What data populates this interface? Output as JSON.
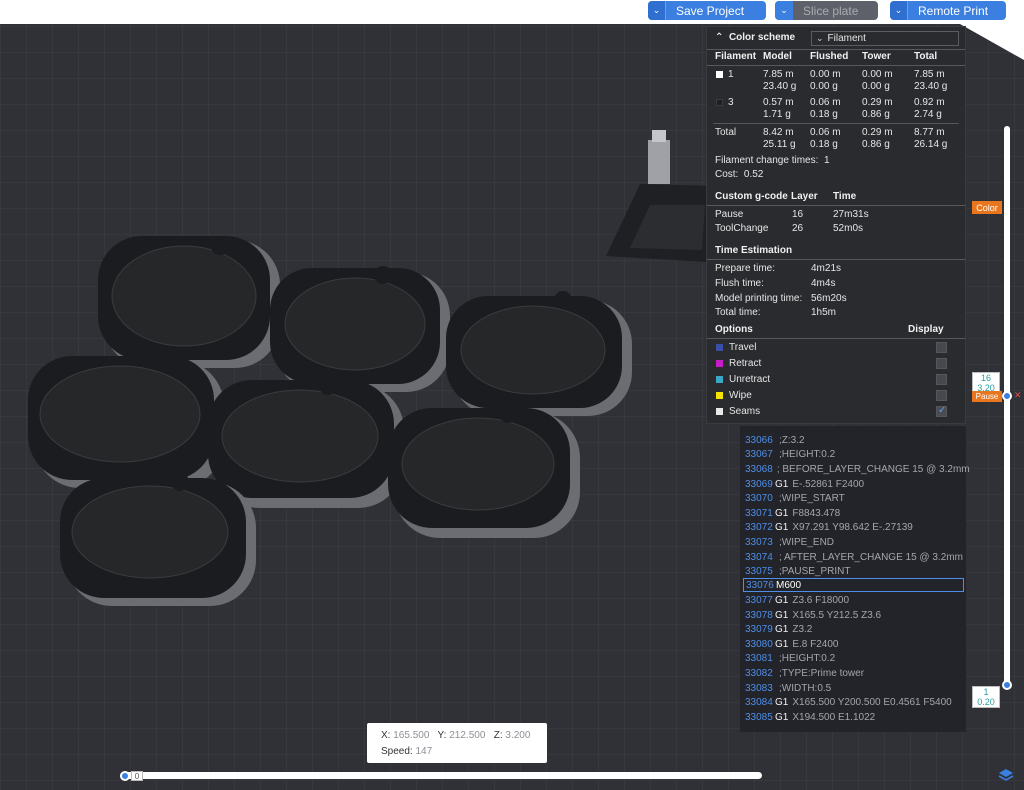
{
  "toolbar": {
    "save_project": "Save Project",
    "slice_plate": "Slice plate",
    "remote_print": "Remote Print"
  },
  "color_scheme": {
    "title": "Color scheme",
    "selected": "Filament"
  },
  "filament_table": {
    "headers": [
      "Filament",
      "Model",
      "Flushed",
      "Tower",
      "Total"
    ],
    "rows": [
      {
        "id": "1",
        "color": "#ffffff",
        "model": [
          "7.85 m",
          "23.40 g"
        ],
        "flushed": [
          "0.00 m",
          "0.00 g"
        ],
        "tower": [
          "0.00 m",
          "0.00 g"
        ],
        "total": [
          "7.85 m",
          "23.40 g"
        ]
      },
      {
        "id": "3",
        "color": "#2f3136",
        "model": [
          "0.57 m",
          "1.71 g"
        ],
        "flushed": [
          "0.06 m",
          "0.18 g"
        ],
        "tower": [
          "0.29 m",
          "0.86 g"
        ],
        "total": [
          "0.92 m",
          "2.74 g"
        ]
      }
    ],
    "total": {
      "label": "Total",
      "model": [
        "8.42 m",
        "25.11 g"
      ],
      "flushed": [
        "0.06 m",
        "0.18 g"
      ],
      "tower": [
        "0.29 m",
        "0.86 g"
      ],
      "total": [
        "8.77 m",
        "26.14 g"
      ]
    },
    "change_times_label": "Filament change times:",
    "change_times_value": "1",
    "cost_label": "Cost:",
    "cost_value": "0.52"
  },
  "custom_gcode": {
    "headers": [
      "Custom g-code",
      "Layer",
      "Time"
    ],
    "rows": [
      {
        "name": "Pause",
        "layer": "16",
        "time": "27m31s"
      },
      {
        "name": "ToolChange",
        "layer": "26",
        "time": "52m0s"
      }
    ]
  },
  "time_estimation": {
    "title": "Time Estimation",
    "rows": [
      {
        "label": "Prepare time:",
        "value": "4m21s"
      },
      {
        "label": "Flush time:",
        "value": "4m4s"
      },
      {
        "label": "Model printing time:",
        "value": "56m20s"
      },
      {
        "label": "Total time:",
        "value": "1h5m"
      }
    ]
  },
  "options": {
    "title": "Options",
    "display_header": "Display",
    "items": [
      {
        "label": "Travel",
        "color": "#3b4fa8",
        "checked": false
      },
      {
        "label": "Retract",
        "color": "#c51ec9",
        "checked": false
      },
      {
        "label": "Unretract",
        "color": "#3aa7c9",
        "checked": false
      },
      {
        "label": "Wipe",
        "color": "#f2e400",
        "checked": false
      },
      {
        "label": "Seams",
        "color": "#e8e8e8",
        "checked": true
      }
    ]
  },
  "gcode_lines": [
    {
      "num": "33066",
      "op": "",
      "text": ";Z:3.2"
    },
    {
      "num": "33067",
      "op": "",
      "text": ";HEIGHT:0.2"
    },
    {
      "num": "33068",
      "op": "",
      "text": "; BEFORE_LAYER_CHANGE 15 @ 3.2mm"
    },
    {
      "num": "33069",
      "op": "G1",
      "text": "E-.52861 F2400"
    },
    {
      "num": "33070",
      "op": "",
      "text": ";WIPE_START"
    },
    {
      "num": "33071",
      "op": "G1",
      "text": "F8843.478"
    },
    {
      "num": "33072",
      "op": "G1",
      "text": "X97.291 Y98.642 E-.27139"
    },
    {
      "num": "33073",
      "op": "",
      "text": ";WIPE_END"
    },
    {
      "num": "33074",
      "op": "",
      "text": "; AFTER_LAYER_CHANGE 15 @ 3.2mm"
    },
    {
      "num": "33075",
      "op": "",
      "text": ";PAUSE_PRINT"
    },
    {
      "num": "33076",
      "op": "M600",
      "text": ""
    },
    {
      "num": "33077",
      "op": "G1",
      "text": "Z3.6 F18000"
    },
    {
      "num": "33078",
      "op": "G1",
      "text": "X165.5 Y212.5 Z3.6"
    },
    {
      "num": "33079",
      "op": "G1",
      "text": "Z3.2"
    },
    {
      "num": "33080",
      "op": "G1",
      "text": "E.8 F2400"
    },
    {
      "num": "33081",
      "op": "",
      "text": ";HEIGHT:0.2"
    },
    {
      "num": "33082",
      "op": "",
      "text": ";TYPE:Prime tower"
    },
    {
      "num": "33083",
      "op": "",
      "text": ";WIDTH:0.5"
    },
    {
      "num": "33084",
      "op": "G1",
      "text": "X165.500 Y200.500 E0.4561 F5400"
    },
    {
      "num": "33085",
      "op": "G1",
      "text": "X194.500 E1.1022"
    }
  ],
  "layer_slider": {
    "color_label": "Color",
    "pause_label": "Pause",
    "top_layer": "16",
    "top_height": "3.20",
    "bottom_layer": "1",
    "bottom_height": "0.20"
  },
  "position_info": {
    "x_label": "X:",
    "x_value": "165.500",
    "y_label": "Y:",
    "y_value": "212.500",
    "z_label": "Z:",
    "z_value": "3.200",
    "speed_label": "Speed:",
    "speed_value": "147"
  },
  "move_slider": {
    "value": "0"
  }
}
